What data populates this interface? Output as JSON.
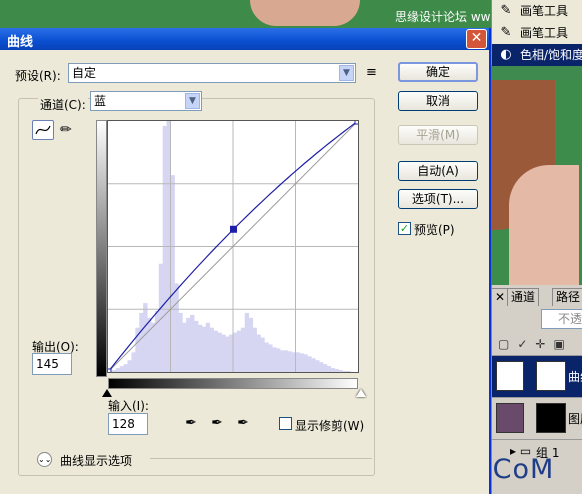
{
  "background": {
    "watermark_top": "思缘设计论坛 www.missyuan.com",
    "watermark_bottom": "UiBQ.CoM",
    "menu": [
      {
        "icon": "brush-icon",
        "label": "画笔工具"
      },
      {
        "icon": "brush-icon",
        "label": "画笔工具"
      },
      {
        "icon": "adjustment-icon",
        "label": "色相/饱和度"
      }
    ],
    "layers_panel": {
      "tabs": [
        "通道",
        "路径"
      ],
      "opacity_label": "不透",
      "layers": [
        {
          "name": "曲线"
        },
        {
          "name": "图层"
        },
        {
          "name": "组 1"
        }
      ]
    }
  },
  "dialog": {
    "title": "曲线",
    "close_label": "✕",
    "preset_label": "预设(R):",
    "preset_value": "自定",
    "preset_menu_icon": "≡",
    "channel_label": "通道(C):",
    "channel_value": "蓝",
    "buttons": {
      "ok": "确定",
      "cancel": "取消",
      "smooth": "平滑(M)",
      "auto": "自动(A)",
      "options": "选项(T)..."
    },
    "preview_label": "预览(P)",
    "preview_checked": true,
    "output_label": "输出(O):",
    "output_value": "145",
    "input_label": "输入(I):",
    "input_value": "128",
    "clipping_label": "显示修剪(W)",
    "clipping_checked": false,
    "display_options_label": "曲线显示选项",
    "colors": {
      "title_bar": "#0a4fd0",
      "histogram": "#d6d6f3",
      "curve": "#1e1ea8"
    }
  },
  "chart_data": {
    "type": "line",
    "channel": "蓝",
    "xlim": [
      0,
      255
    ],
    "ylim": [
      0,
      255
    ],
    "grid": "4x4",
    "curve_points": [
      [
        0,
        0
      ],
      [
        128,
        145
      ],
      [
        255,
        255
      ]
    ],
    "selected_point": [
      128,
      145
    ],
    "histogram": [
      0,
      2,
      4,
      6,
      8,
      12,
      20,
      45,
      60,
      70,
      55,
      50,
      62,
      110,
      250,
      255,
      200,
      90,
      60,
      50,
      55,
      58,
      52,
      48,
      46,
      50,
      45,
      42,
      40,
      38,
      36,
      38,
      40,
      42,
      45,
      60,
      55,
      45,
      38,
      35,
      30,
      28,
      25,
      24,
      22,
      22,
      21,
      20,
      20,
      19,
      18,
      16,
      14,
      12,
      10,
      8,
      6,
      4,
      3,
      2,
      1,
      1,
      0,
      0
    ]
  }
}
